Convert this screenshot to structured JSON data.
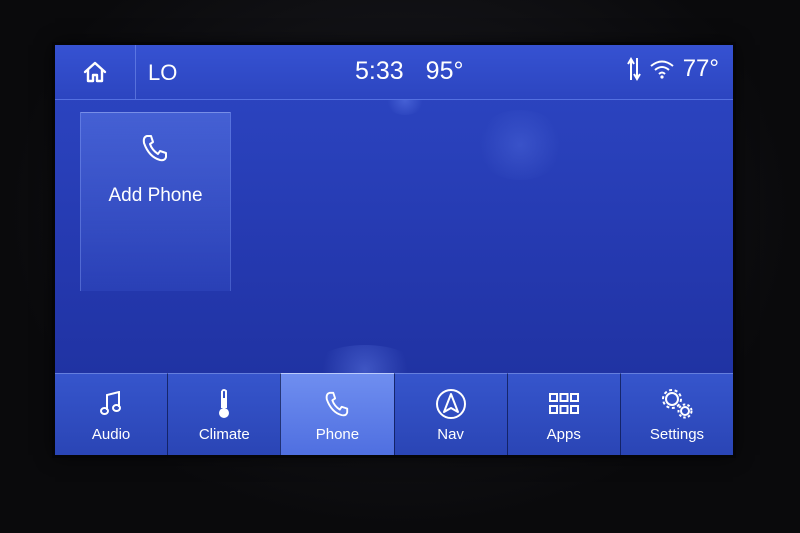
{
  "status_bar": {
    "home_icon": "home-icon",
    "climate_mode": "LO",
    "time": "5:33",
    "outside_temp": "95°",
    "cabin_temp": "77°",
    "data_icon": "data-transfer-icon",
    "wifi_icon": "wifi-icon"
  },
  "main": {
    "add_phone_tile": {
      "label": "Add Phone",
      "icon": "phone-icon"
    }
  },
  "nav_bar": {
    "active": "Phone",
    "items": [
      {
        "label": "Audio",
        "icon": "music-note-icon"
      },
      {
        "label": "Climate",
        "icon": "thermometer-icon"
      },
      {
        "label": "Phone",
        "icon": "phone-icon"
      },
      {
        "label": "Nav",
        "icon": "navigation-arrow-icon"
      },
      {
        "label": "Apps",
        "icon": "apps-grid-icon"
      },
      {
        "label": "Settings",
        "icon": "gears-icon"
      }
    ]
  },
  "colors": {
    "screen_bg": "#2438ae",
    "active_tab": "#6f8ef0",
    "text": "#ffffff"
  }
}
